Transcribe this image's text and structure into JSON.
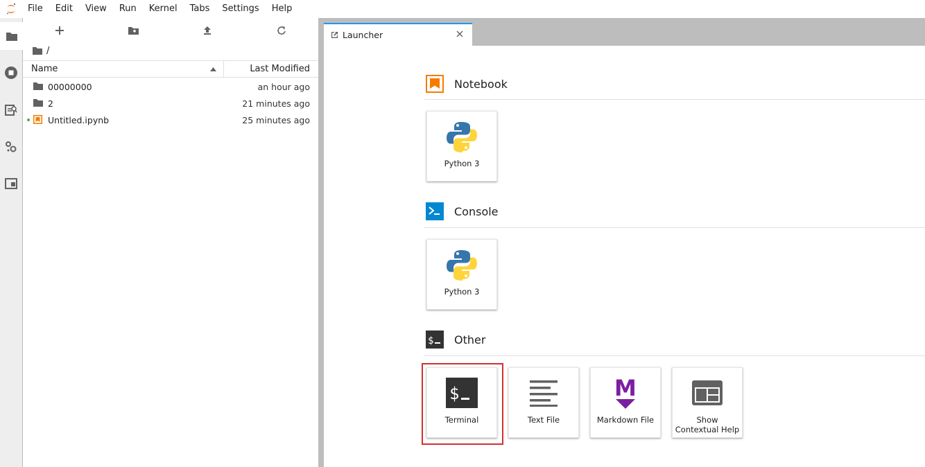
{
  "menu": [
    "File",
    "Edit",
    "View",
    "Run",
    "Kernel",
    "Tabs",
    "Settings",
    "Help"
  ],
  "icons": {
    "logo": "jupyter-logo-icon",
    "activity": [
      "folder-icon",
      "running-icon",
      "commands-icon",
      "property-inspector-icon",
      "tabs-icon"
    ],
    "toolbar": [
      "new-launcher-icon",
      "new-folder-icon",
      "upload-icon",
      "refresh-icon"
    ]
  },
  "filebrowser": {
    "breadcrumb": "/",
    "columns": {
      "name": "Name",
      "modified": "Last Modified"
    },
    "files": [
      {
        "name": "00000000",
        "modified": "an hour ago",
        "type": "folder",
        "running": false
      },
      {
        "name": "2",
        "modified": "21 minutes ago",
        "type": "folder",
        "running": false
      },
      {
        "name": "Untitled.ipynb",
        "modified": "25 minutes ago",
        "type": "notebook",
        "running": true
      }
    ]
  },
  "tab": {
    "label": "Launcher"
  },
  "launcher": {
    "sections": [
      {
        "title": "Notebook",
        "cards": [
          "Python 3"
        ]
      },
      {
        "title": "Console",
        "cards": [
          "Python 3"
        ]
      },
      {
        "title": "Other",
        "cards": [
          "Terminal",
          "Text File",
          "Markdown File",
          "Show Contextual Help"
        ]
      }
    ]
  },
  "colors": {
    "accent": "#2196f3",
    "notebook": "#f57c00",
    "console": "#0288d1",
    "markdown": "#7b1fa2",
    "highlight": "#d32f2f",
    "running": "#4caf50"
  }
}
